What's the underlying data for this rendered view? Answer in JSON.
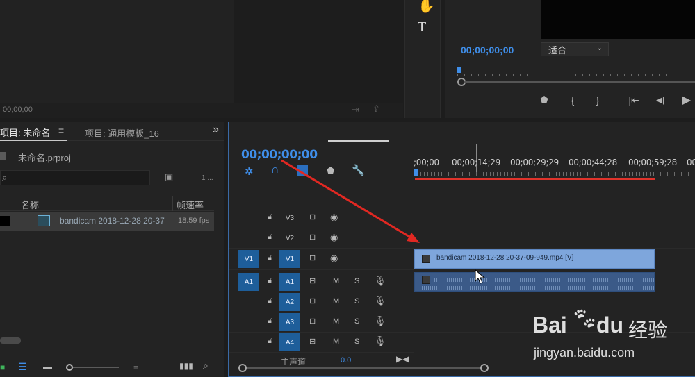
{
  "source_monitor": {
    "timecode": "00;00;00"
  },
  "tools": {
    "hand_icon": "hand-icon",
    "type_icon": "T"
  },
  "program_monitor": {
    "timecode": "00;00;00;00",
    "fit_select": "适合",
    "controls": [
      "mark-in",
      "{",
      "}",
      "go-to-in",
      "step-back",
      "play"
    ]
  },
  "project_panel": {
    "tab_active": "项目: 未命名",
    "tab_menu": "≡",
    "tab_other": "项目: 通用模板_16",
    "overflow": "»",
    "file_name": "未命名.prproj",
    "count": "1 ...",
    "col_name": "名称",
    "col_fps": "帧速率",
    "row_name": "bandicam 2018-12-28 20-37",
    "row_fps": "18.59 fps"
  },
  "timeline": {
    "timecode": "00;00;00;00",
    "ruler_labels": [
      ";00;00",
      "00;00;14;29",
      "00;00;29;29",
      "00;00;44;28",
      "00;00;59;28",
      "00"
    ],
    "tracks": [
      {
        "src": "",
        "name": "V3",
        "kind": "video"
      },
      {
        "src": "",
        "name": "V2",
        "kind": "video"
      },
      {
        "src": "V1",
        "name": "V1",
        "kind": "video"
      },
      {
        "src": "A1",
        "name": "A1",
        "kind": "audio",
        "m": "M",
        "s": "S"
      },
      {
        "src": "",
        "name": "A2",
        "kind": "audio",
        "m": "M",
        "s": "S"
      },
      {
        "src": "",
        "name": "A3",
        "kind": "audio",
        "m": "M",
        "s": "S"
      },
      {
        "src": "",
        "name": "A4",
        "kind": "audio",
        "m": "M",
        "s": "S"
      }
    ],
    "master_label": "主声道",
    "master_value": "0.0",
    "video_clip": "bandicam 2018-12-28 20-37-09-949.mp4 [V]"
  },
  "watermark": {
    "brand": "Bai",
    "brand2": "du",
    "cn": "经验",
    "url": "jingyan.baidu.com"
  },
  "colors": {
    "accent": "#3f8ee9",
    "clip_video": "#7ea6dc",
    "clip_audio": "#3b5a88",
    "workarea": "#e0332b"
  }
}
